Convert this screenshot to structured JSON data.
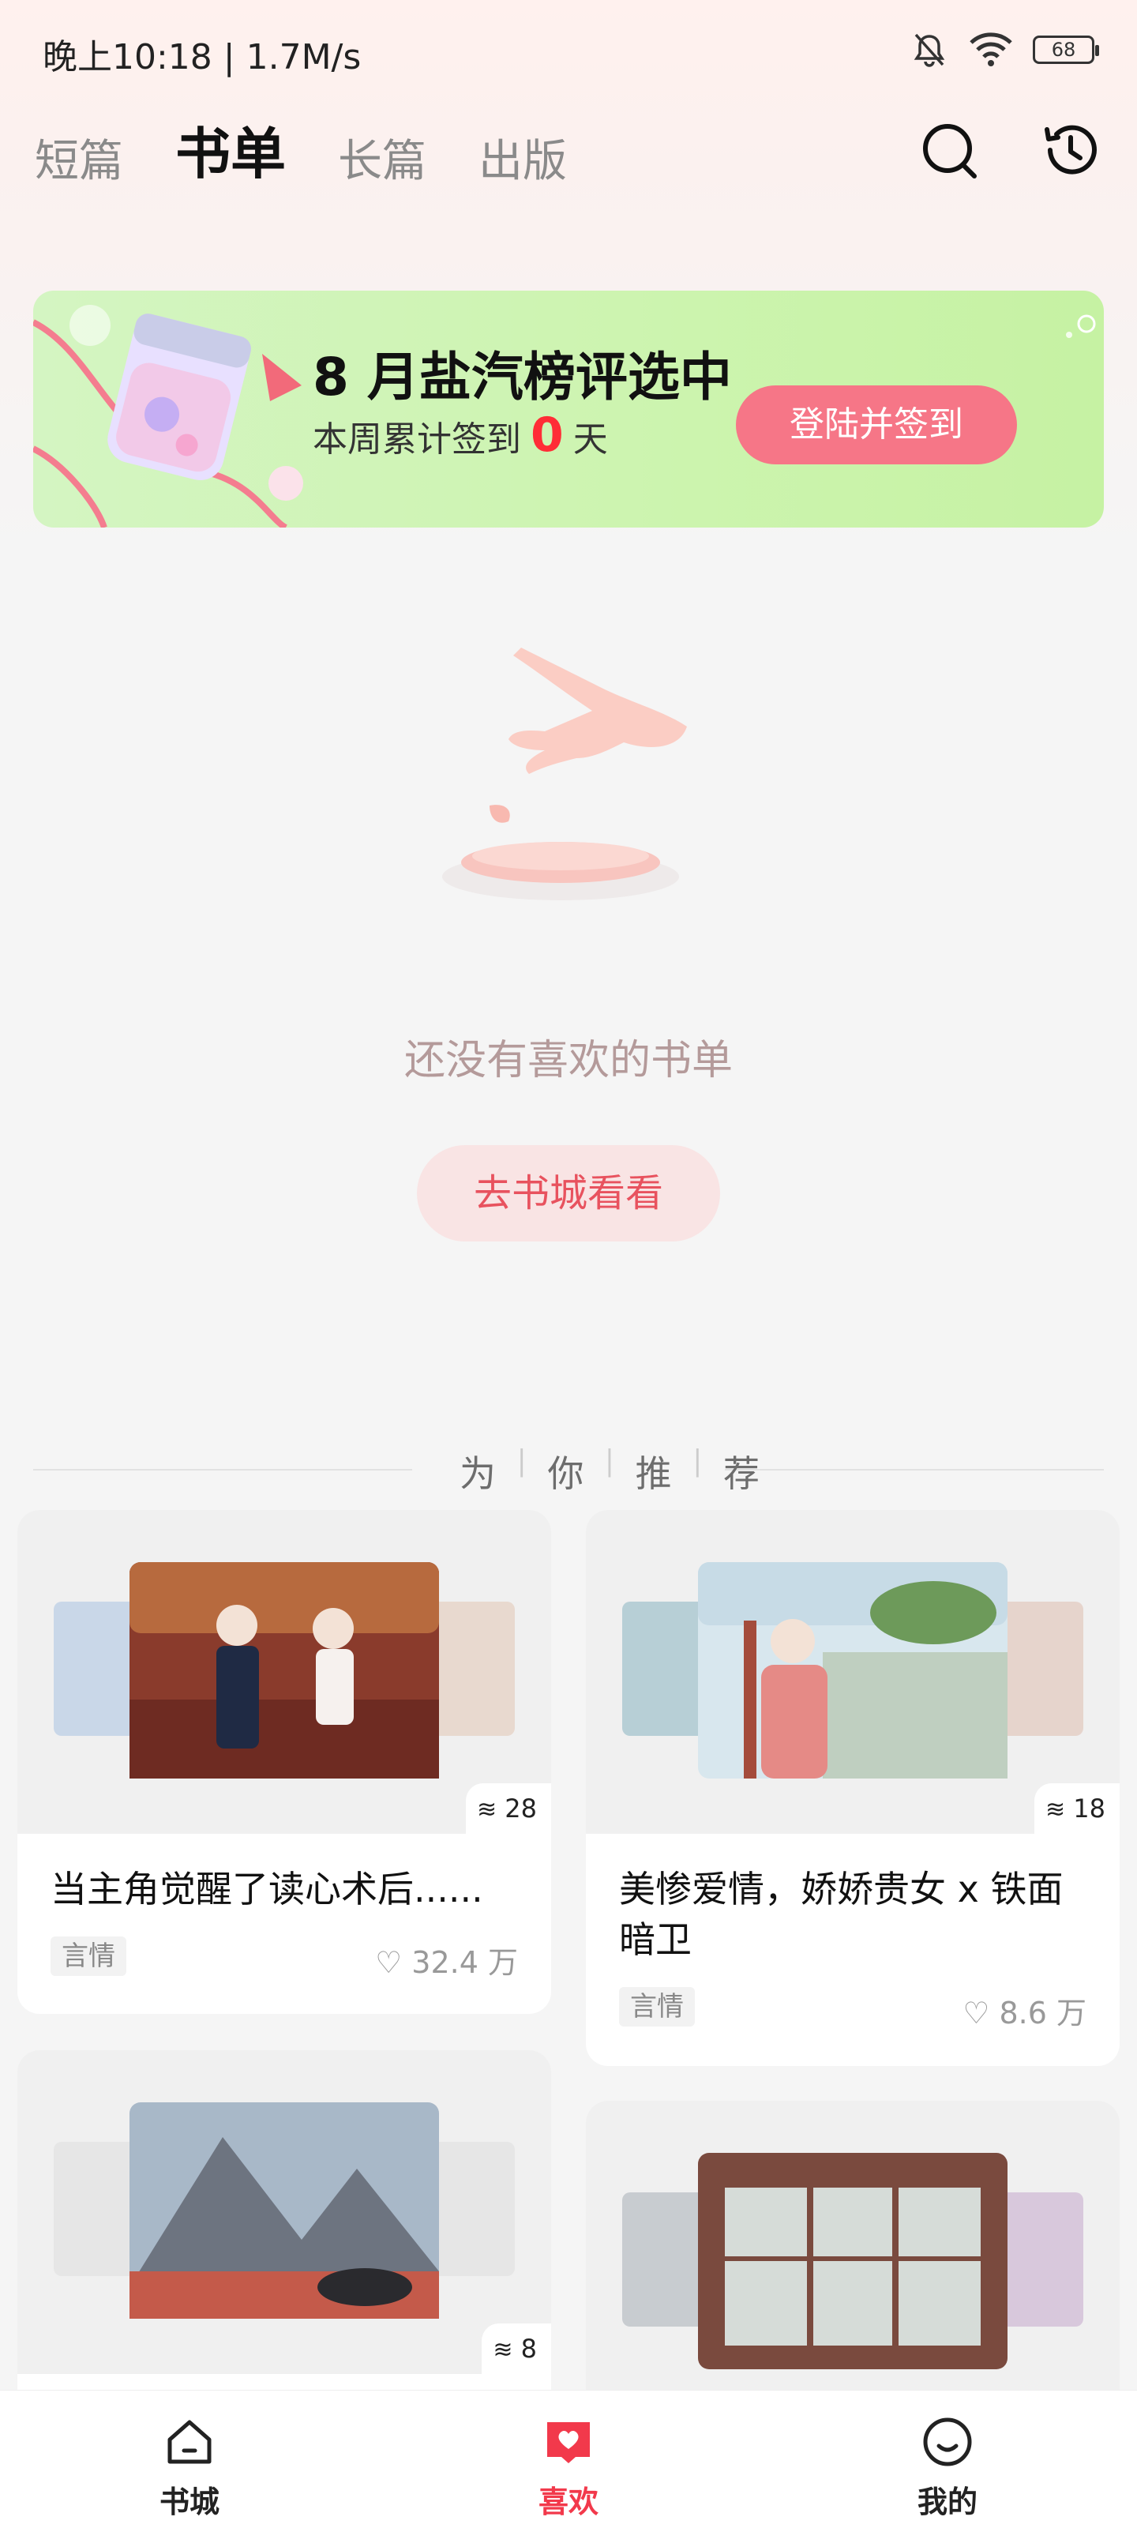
{
  "status_bar": {
    "time": "晚上10:18 | 1.7M/s",
    "battery": "68"
  },
  "tabs": [
    {
      "label": "短篇"
    },
    {
      "label": "书单"
    },
    {
      "label": "长篇"
    },
    {
      "label": "出版"
    }
  ],
  "banner": {
    "title": "8 月盐汽榜评选中",
    "sub_prefix": "本周累计签到",
    "sub_count": "0",
    "sub_suffix": "天",
    "button": "登陆并签到"
  },
  "empty_state": {
    "text": "还没有喜欢的书单",
    "button": "去书城看看"
  },
  "recommend": {
    "chars": [
      "为",
      "你",
      "推",
      "荐"
    ]
  },
  "cards": [
    {
      "title": "当主角觉醒了读心术后......",
      "tag": "言情",
      "likes": "32.4 万",
      "count": "28"
    },
    {
      "title": "美惨爱情，娇娇贵女 x 铁面暗卫",
      "tag": "言情",
      "likes": "8.6 万",
      "count": "18"
    },
    {
      "count": "8"
    }
  ],
  "bottom_nav": [
    {
      "label": "书城",
      "icon": "home-icon"
    },
    {
      "label": "喜欢",
      "icon": "heart-icon"
    },
    {
      "label": "我的",
      "icon": "profile-icon"
    }
  ],
  "colors": {
    "accent": "#f2394b",
    "banner_cta": "#f67687",
    "banner_bg": "#cdf4b0"
  }
}
